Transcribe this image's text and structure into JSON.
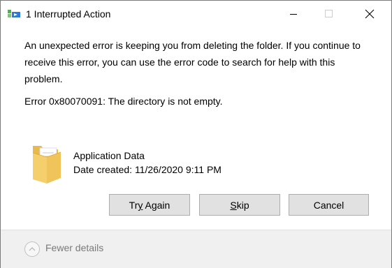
{
  "window": {
    "title": "1 Interrupted Action",
    "controls": {
      "minimize": "minimize-icon",
      "maximize": "maximize-icon",
      "close": "close-icon"
    }
  },
  "message": {
    "body": "An unexpected error is keeping you from deleting the folder. If you continue to receive this error, you can use the error code to search for help with this problem.",
    "error": "Error 0x80070091: The directory is not empty."
  },
  "file": {
    "icon": "folder-icon",
    "name": "Application Data",
    "date_created": "Date created: 11/26/2020 9:11 PM"
  },
  "buttons": {
    "try_again": {
      "prefix": "Tr",
      "accel": "y",
      "suffix": " Again"
    },
    "skip": {
      "prefix": "",
      "accel": "S",
      "suffix": "kip"
    },
    "cancel": "Cancel"
  },
  "footer": {
    "details_label": "Fewer details",
    "icon": "chevron-up-icon"
  },
  "colors": {
    "button_face": "#e1e1e1",
    "button_border": "#adadad",
    "footer_bg": "#f0f0f0",
    "disabled_text": "#7a7a7a"
  }
}
